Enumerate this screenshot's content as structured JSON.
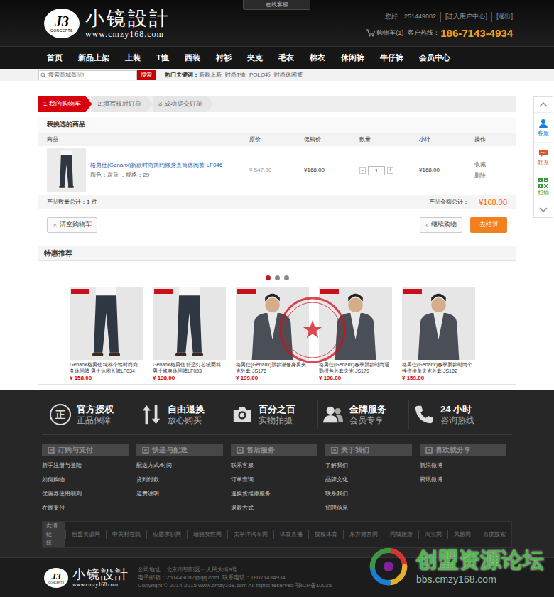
{
  "header": {
    "online_tab": "在线客服",
    "logo": {
      "mark": "J3",
      "sub": "CONCEPTS",
      "title": "小镜設計",
      "url": "www.cmzy168.com"
    },
    "greeting": "您好，251449082",
    "user_center": "[进入用户中心]",
    "logout": "[退出]",
    "cart_label": "购物车(",
    "cart_count": "1",
    "cart_close": ")",
    "hotline_label": "客户热线：",
    "hotline": "186-7143-4934"
  },
  "nav": [
    "首页",
    "新品上架",
    "上装",
    "T恤",
    "西装",
    "衬衫",
    "夹克",
    "毛衣",
    "棉衣",
    "休闲裤",
    "牛仔裤",
    "会员中心"
  ],
  "search": {
    "placeholder": "搜索商城商品!",
    "button": "搜索",
    "hot_label": "热门关键词：",
    "hot": [
      "新款上新",
      "时尚T恤",
      "POLO衫",
      "时尚休闲裤"
    ]
  },
  "steps": [
    {
      "label": "1.我的购物车",
      "selected": true
    },
    {
      "label": "2.填写核对订单",
      "selected": false
    },
    {
      "label": "3.成功提交订单",
      "selected": false
    }
  ],
  "cart": {
    "title": "我挑选的商品",
    "columns": [
      "商品",
      "原价",
      "促销价",
      "数量",
      "小计",
      "操作"
    ],
    "rows": [
      {
        "kind": "pants",
        "name": "格男仕(Genanx)新款时尚简约修身直筒休闲裤 LF046",
        "spec": "颜色：灰蓝 ，规格：29",
        "original": "¥ 547.00",
        "price": "¥168.00",
        "minus": "-",
        "qty": "1",
        "plus": "+",
        "subtotal": "¥168.00",
        "actions": [
          "收藏",
          "删除"
        ]
      }
    ],
    "count_label": "产品数量总计：",
    "count": "1 件",
    "total_label": "产品金额总计：",
    "total": "¥168.00",
    "clear_icon": "×",
    "clear": "清空购物车",
    "continue_icon": "‹",
    "continue": "继续购物",
    "checkout": "去结算"
  },
  "recommend": {
    "title": "特惠推荐",
    "dots": [
      {
        "selected": true
      },
      {
        "selected": false
      },
      {
        "selected": false
      }
    ],
    "products": [
      {
        "kind": "pants",
        "name": "Genanx格男仕 纯棉个性时尚商务休闲裤 男士休闲长裤LF034",
        "price": "¥ 158.00"
      },
      {
        "kind": "pants",
        "name": "Genanx格男仕 舒适灯芯绒面料男士修身休闲裤LF033",
        "price": "¥ 198.00"
      },
      {
        "kind": "jacket",
        "name": "格男仕(Genanx)新款潮修身男夹克外套 JS178",
        "price": "¥ 199.00"
      },
      {
        "kind": "jacket",
        "name": "格男仕(Genanx)春季新款时尚通勤拼色外套夹克 JS179",
        "price": "¥ 196.00"
      },
      {
        "kind": "jacket",
        "name": "格男仕(Genanx)春季新款时尚个性拼接单夹克外套 JS182",
        "price": "¥ 159.00"
      }
    ]
  },
  "side_float": {
    "items": [
      {
        "label": "客服",
        "kind": "service",
        "color": "#1a7fd4"
      },
      {
        "label": "联系",
        "kind": "chat",
        "color": "#e0532b"
      },
      {
        "label": "扫描",
        "kind": "qr",
        "color": "#3b9b3b"
      }
    ]
  },
  "footer": {
    "features": [
      {
        "kind": "glyph",
        "glyph": "正",
        "title": "官方授权",
        "sub": "正品保障"
      },
      {
        "kind": "exchange",
        "title": "自由退换",
        "sub": "放心购买"
      },
      {
        "kind": "camera",
        "title": "百分之百",
        "sub": "实物拍摄"
      },
      {
        "kind": "people",
        "title": "金牌服务",
        "sub": "会员专享"
      },
      {
        "kind": "phone",
        "title": "24 小时",
        "sub": "咨询热线"
      }
    ],
    "columns": [
      {
        "title": "订购与支付",
        "links": [
          "新手注册与登陆",
          "如何购物",
          "优惠券使用细则",
          "在线支付"
        ]
      },
      {
        "title": "快递与配送",
        "links": [
          "配送方式/时间",
          "货到付款",
          "运费说明"
        ]
      },
      {
        "title": "售后服务",
        "links": [
          "联系客服",
          "订单查询",
          "退换货维修服务",
          "退款方式"
        ]
      },
      {
        "title": "关于我们",
        "links": [
          "了解我们",
          "品牌文化",
          "联系我们",
          "招聘信息"
        ]
      },
      {
        "title": "喜欢就分享",
        "links": [
          "新浪微博",
          "腾讯微博"
        ]
      }
    ],
    "friends_label": "友情链接：",
    "friends": [
      "创盟资源网",
      "中关村在线",
      "应届求职网",
      "瑞丽女性网",
      "太平洋汽车网",
      "体育直播",
      "搜狐体育",
      "东方财富网",
      "同城旅游",
      "淘宝网",
      "凤凰网",
      "百度搜索"
    ],
    "address": "公司地址：北京市朝阳区一人民大街9号",
    "contact": "电子邮箱：251449082@qq.com  联系电话：18071434934",
    "copyright": "Copyright © 2014-2015 www.cmzy168.com All rights reserved 鄂ICP备10025"
  },
  "watermark": {
    "title": "创盟资源论坛",
    "url": "bbs.cmzy168.com"
  }
}
